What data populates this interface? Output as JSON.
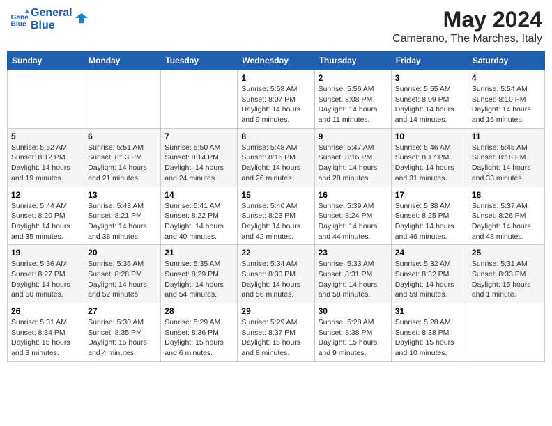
{
  "header": {
    "logo_line1": "General",
    "logo_line2": "Blue",
    "main_title": "May 2024",
    "subtitle": "Camerano, The Marches, Italy"
  },
  "days_of_week": [
    "Sunday",
    "Monday",
    "Tuesday",
    "Wednesday",
    "Thursday",
    "Friday",
    "Saturday"
  ],
  "weeks": [
    [
      {
        "day": "",
        "info": ""
      },
      {
        "day": "",
        "info": ""
      },
      {
        "day": "",
        "info": ""
      },
      {
        "day": "1",
        "info": "Sunrise: 5:58 AM\nSunset: 8:07 PM\nDaylight: 14 hours\nand 9 minutes."
      },
      {
        "day": "2",
        "info": "Sunrise: 5:56 AM\nSunset: 8:08 PM\nDaylight: 14 hours\nand 11 minutes."
      },
      {
        "day": "3",
        "info": "Sunrise: 5:55 AM\nSunset: 8:09 PM\nDaylight: 14 hours\nand 14 minutes."
      },
      {
        "day": "4",
        "info": "Sunrise: 5:54 AM\nSunset: 8:10 PM\nDaylight: 14 hours\nand 16 minutes."
      }
    ],
    [
      {
        "day": "5",
        "info": "Sunrise: 5:52 AM\nSunset: 8:12 PM\nDaylight: 14 hours\nand 19 minutes."
      },
      {
        "day": "6",
        "info": "Sunrise: 5:51 AM\nSunset: 8:13 PM\nDaylight: 14 hours\nand 21 minutes."
      },
      {
        "day": "7",
        "info": "Sunrise: 5:50 AM\nSunset: 8:14 PM\nDaylight: 14 hours\nand 24 minutes."
      },
      {
        "day": "8",
        "info": "Sunrise: 5:48 AM\nSunset: 8:15 PM\nDaylight: 14 hours\nand 26 minutes."
      },
      {
        "day": "9",
        "info": "Sunrise: 5:47 AM\nSunset: 8:16 PM\nDaylight: 14 hours\nand 28 minutes."
      },
      {
        "day": "10",
        "info": "Sunrise: 5:46 AM\nSunset: 8:17 PM\nDaylight: 14 hours\nand 31 minutes."
      },
      {
        "day": "11",
        "info": "Sunrise: 5:45 AM\nSunset: 8:18 PM\nDaylight: 14 hours\nand 33 minutes."
      }
    ],
    [
      {
        "day": "12",
        "info": "Sunrise: 5:44 AM\nSunset: 8:20 PM\nDaylight: 14 hours\nand 35 minutes."
      },
      {
        "day": "13",
        "info": "Sunrise: 5:43 AM\nSunset: 8:21 PM\nDaylight: 14 hours\nand 38 minutes."
      },
      {
        "day": "14",
        "info": "Sunrise: 5:41 AM\nSunset: 8:22 PM\nDaylight: 14 hours\nand 40 minutes."
      },
      {
        "day": "15",
        "info": "Sunrise: 5:40 AM\nSunset: 8:23 PM\nDaylight: 14 hours\nand 42 minutes."
      },
      {
        "day": "16",
        "info": "Sunrise: 5:39 AM\nSunset: 8:24 PM\nDaylight: 14 hours\nand 44 minutes."
      },
      {
        "day": "17",
        "info": "Sunrise: 5:38 AM\nSunset: 8:25 PM\nDaylight: 14 hours\nand 46 minutes."
      },
      {
        "day": "18",
        "info": "Sunrise: 5:37 AM\nSunset: 8:26 PM\nDaylight: 14 hours\nand 48 minutes."
      }
    ],
    [
      {
        "day": "19",
        "info": "Sunrise: 5:36 AM\nSunset: 8:27 PM\nDaylight: 14 hours\nand 50 minutes."
      },
      {
        "day": "20",
        "info": "Sunrise: 5:36 AM\nSunset: 8:28 PM\nDaylight: 14 hours\nand 52 minutes."
      },
      {
        "day": "21",
        "info": "Sunrise: 5:35 AM\nSunset: 8:29 PM\nDaylight: 14 hours\nand 54 minutes."
      },
      {
        "day": "22",
        "info": "Sunrise: 5:34 AM\nSunset: 8:30 PM\nDaylight: 14 hours\nand 56 minutes."
      },
      {
        "day": "23",
        "info": "Sunrise: 5:33 AM\nSunset: 8:31 PM\nDaylight: 14 hours\nand 58 minutes."
      },
      {
        "day": "24",
        "info": "Sunrise: 5:32 AM\nSunset: 8:32 PM\nDaylight: 14 hours\nand 59 minutes."
      },
      {
        "day": "25",
        "info": "Sunrise: 5:31 AM\nSunset: 8:33 PM\nDaylight: 15 hours\nand 1 minute."
      }
    ],
    [
      {
        "day": "26",
        "info": "Sunrise: 5:31 AM\nSunset: 8:34 PM\nDaylight: 15 hours\nand 3 minutes."
      },
      {
        "day": "27",
        "info": "Sunrise: 5:30 AM\nSunset: 8:35 PM\nDaylight: 15 hours\nand 4 minutes."
      },
      {
        "day": "28",
        "info": "Sunrise: 5:29 AM\nSunset: 8:36 PM\nDaylight: 15 hours\nand 6 minutes."
      },
      {
        "day": "29",
        "info": "Sunrise: 5:29 AM\nSunset: 8:37 PM\nDaylight: 15 hours\nand 8 minutes."
      },
      {
        "day": "30",
        "info": "Sunrise: 5:28 AM\nSunset: 8:38 PM\nDaylight: 15 hours\nand 9 minutes."
      },
      {
        "day": "31",
        "info": "Sunrise: 5:28 AM\nSunset: 8:38 PM\nDaylight: 15 hours\nand 10 minutes."
      },
      {
        "day": "",
        "info": ""
      }
    ]
  ]
}
